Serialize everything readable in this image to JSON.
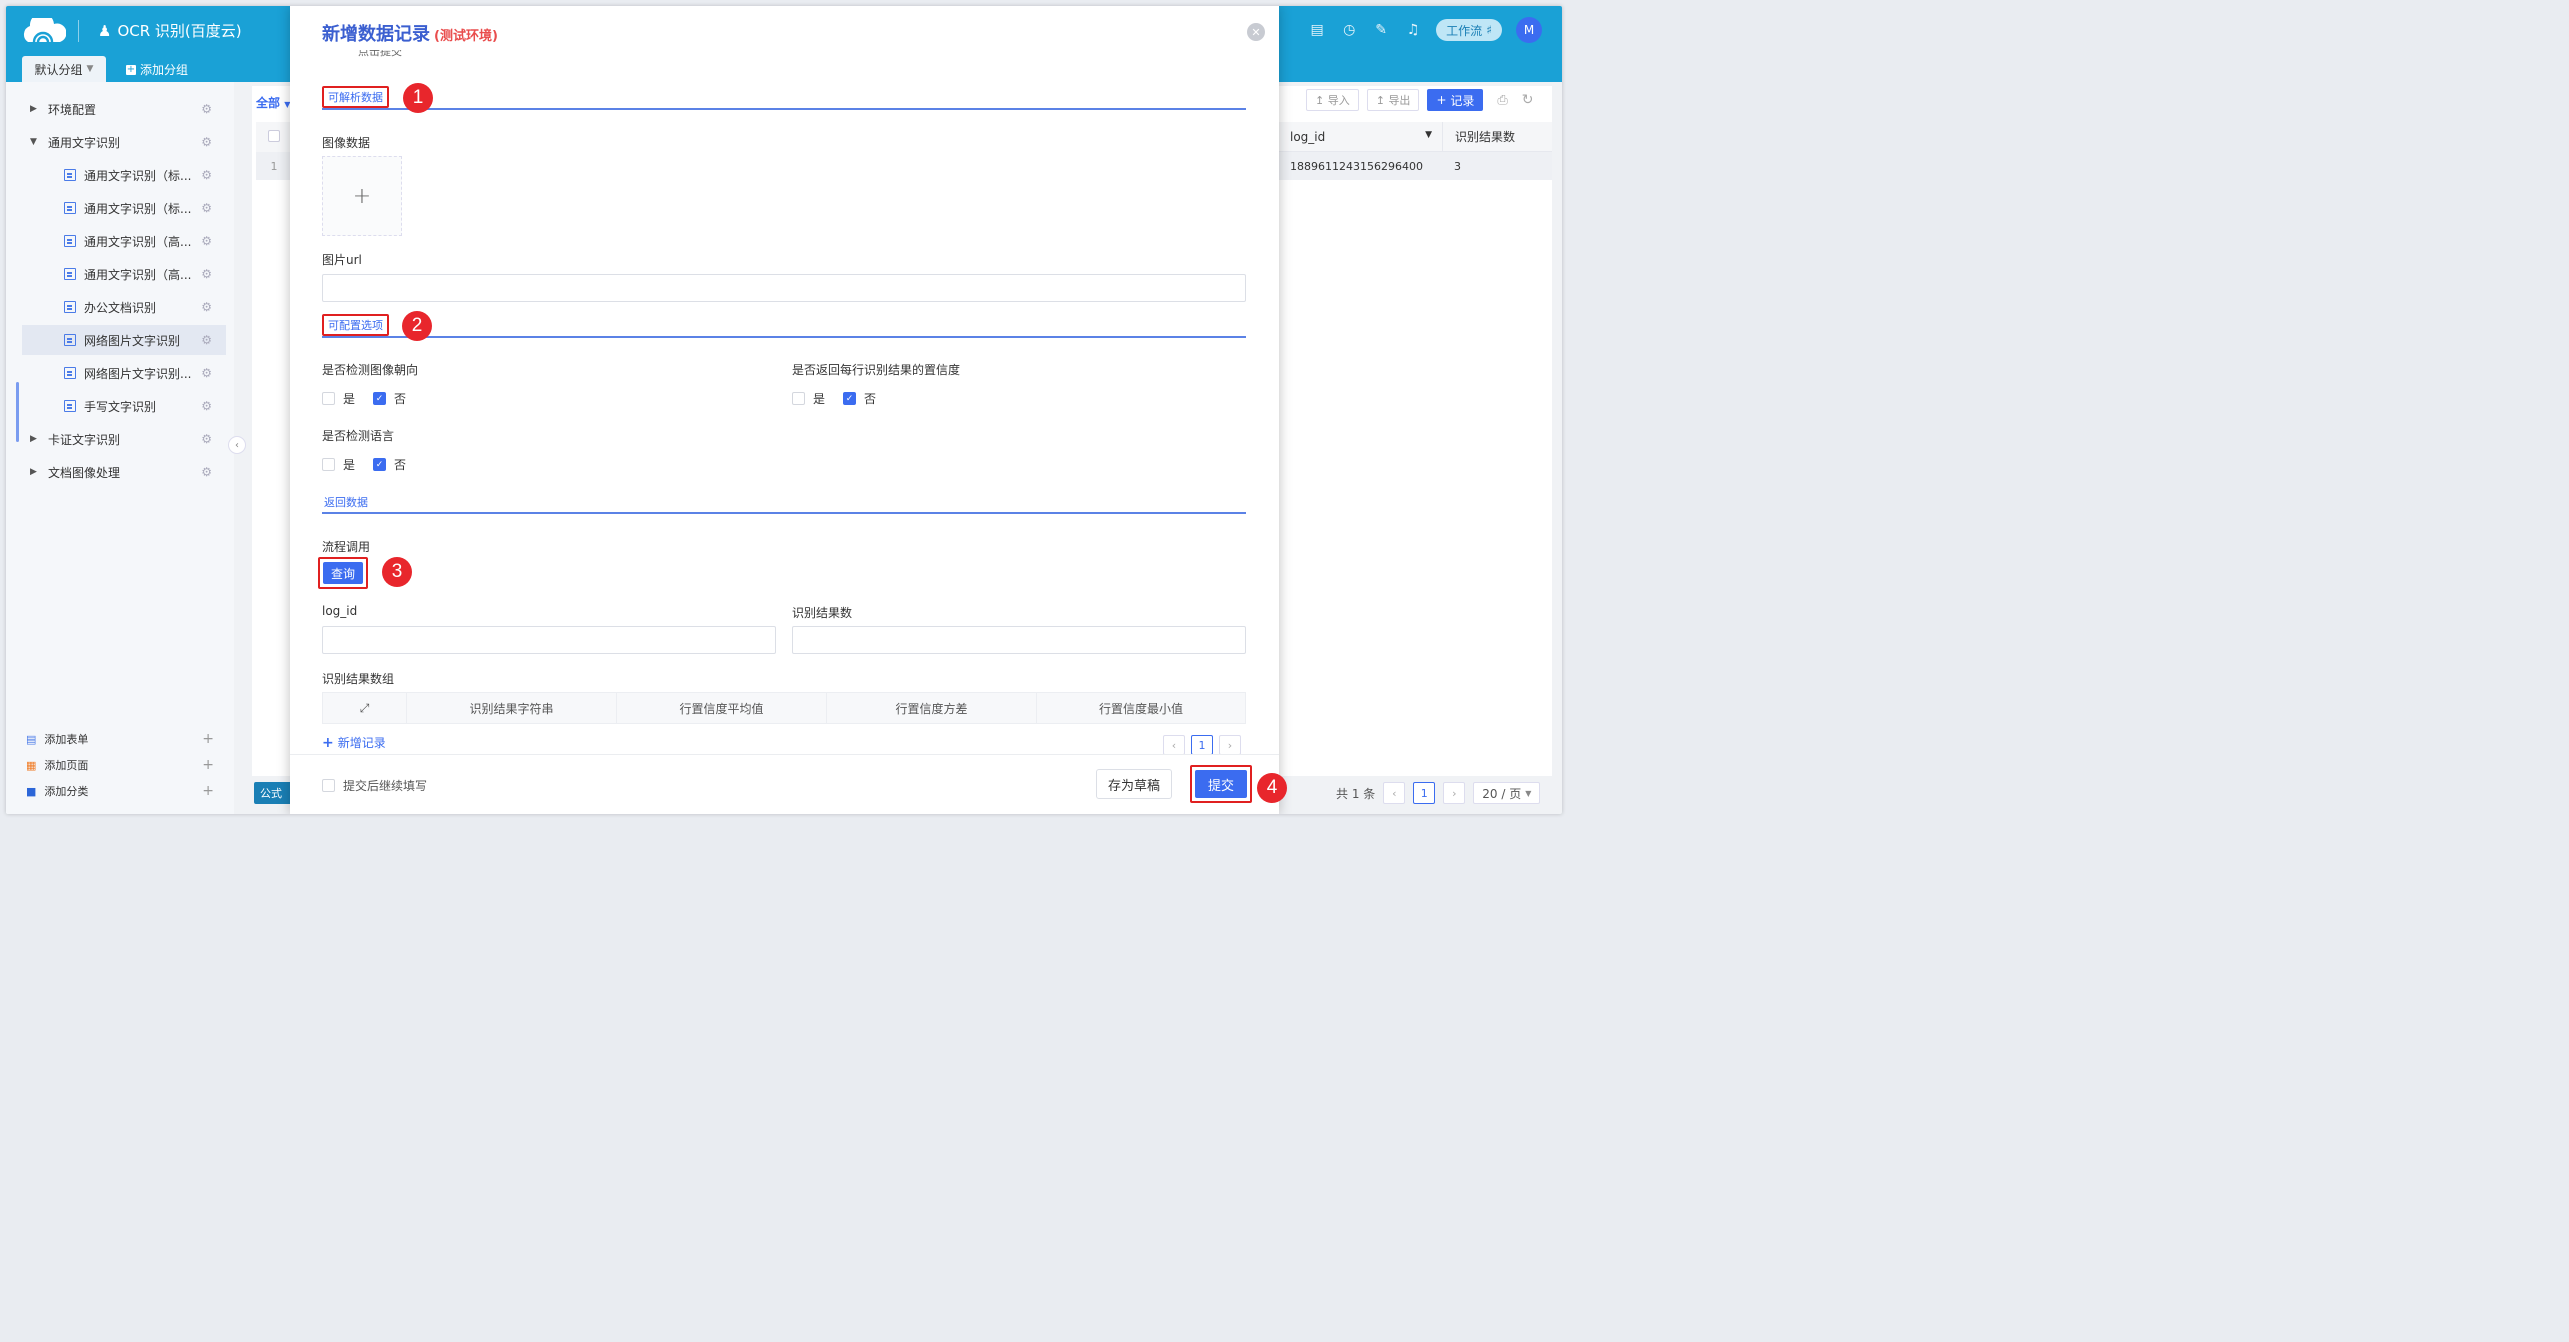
{
  "header": {
    "app_title": "OCR 识别(百度云)",
    "workflow_label": "工作流",
    "avatar_letter": "M"
  },
  "tabs": {
    "active": "默认分组",
    "add": "添加分组"
  },
  "sidebar": {
    "items": [
      {
        "label": "环境配置"
      },
      {
        "label": "通用文字识别"
      },
      {
        "label": "通用文字识别（标..."
      },
      {
        "label": "通用文字识别（标..."
      },
      {
        "label": "通用文字识别（高..."
      },
      {
        "label": "通用文字识别（高..."
      },
      {
        "label": "办公文档识别"
      },
      {
        "label": "网络图片文字识别"
      },
      {
        "label": "网络图片文字识别..."
      },
      {
        "label": "手写文字识别"
      },
      {
        "label": "卡证文字识别"
      },
      {
        "label": "文档图像处理"
      }
    ],
    "footer": {
      "add_form": "添加表单",
      "add_page": "添加页面",
      "add_category": "添加分类"
    }
  },
  "background": {
    "all_label": "全部",
    "import_label": "导入",
    "export_label": "导出",
    "record_label": "记录",
    "col_log_id": "log_id",
    "col_result_count": "识别结果数",
    "row_index": "1",
    "row_log_id": "1889611243156296400",
    "row_result_count": "3",
    "formula_label": "公式",
    "pager_total": "共 1 条",
    "pager_current": "1",
    "pager_size": "20 / 页"
  },
  "modal": {
    "title": "新增数据记录",
    "env_tag": "(测试环境)",
    "cut_text": "点击提交",
    "section_parse": "可解析数据",
    "image_data_label": "图像数据",
    "image_url_label": "图片url",
    "section_options": "可配置选项",
    "detect_direction_label": "是否检测图像朝向",
    "return_confidence_label": "是否返回每行识别结果的置信度",
    "detect_language_label": "是否检测语言",
    "yes": "是",
    "no": "否",
    "section_return": "返回数据",
    "flow_call_label": "流程调用",
    "query_btn": "查询",
    "log_id_label": "log_id",
    "result_count_label": "识别结果数",
    "result_array_label": "识别结果数组",
    "table_cols": [
      "识别结果字符串",
      "行置信度平均值",
      "行置信度方差",
      "行置信度最小值"
    ],
    "add_record": "新增记录",
    "mini_page": "1",
    "continue_label": "提交后继续填写",
    "draft_btn": "存为草稿",
    "submit_btn": "提交"
  },
  "annotations": [
    "1",
    "2",
    "3",
    "4"
  ]
}
